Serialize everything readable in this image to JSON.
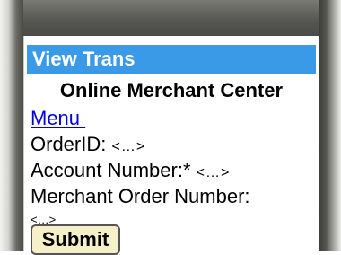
{
  "title_bar": {
    "label": "View Trans"
  },
  "header": {
    "text": "Online Merchant Center"
  },
  "menu_link": {
    "label": "Menu "
  },
  "fields": {
    "order_id": {
      "label": "OrderID:",
      "value": "<…>"
    },
    "account_number": {
      "label": "Account Number:*",
      "value": "<…>"
    },
    "merchant_order_number": {
      "label": "Merchant Order Number:",
      "value": "<…>"
    }
  },
  "submit_button": {
    "label": "Submit"
  },
  "colors": {
    "title_bar_bg": "#3a9ae8",
    "link": "#0000dd",
    "button_bg": "#f5f0c8"
  }
}
